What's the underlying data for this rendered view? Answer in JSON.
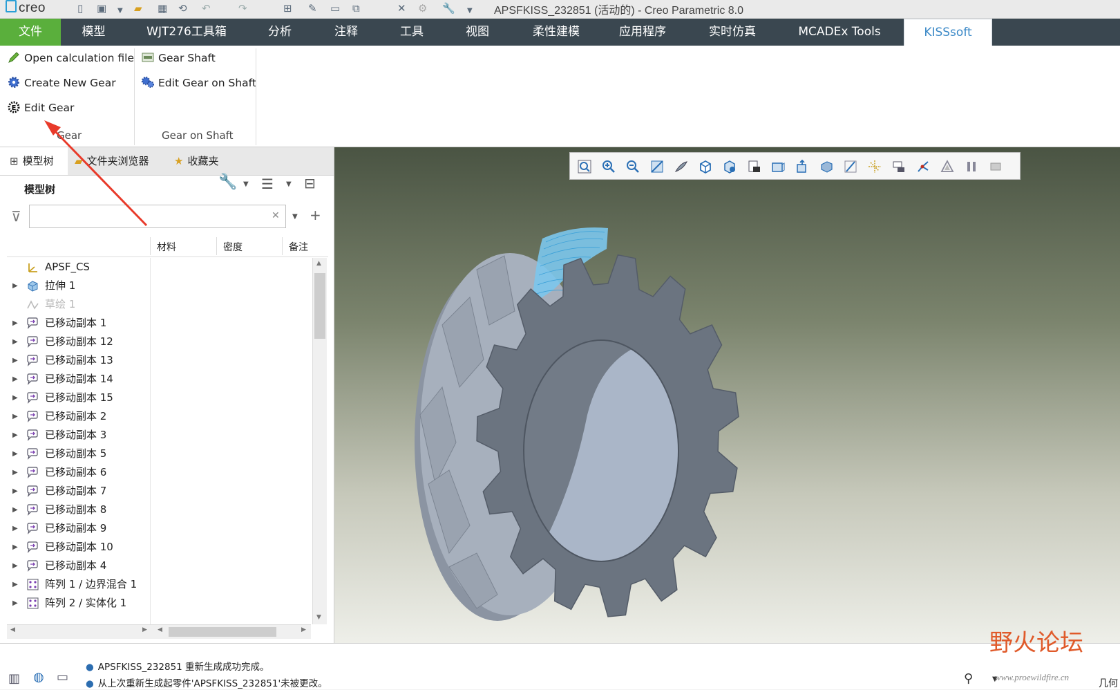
{
  "titlebar": {
    "logo_text": "creo",
    "window_title": "APSFKISS_232851 (活动的) - Creo Parametric 8.0"
  },
  "menu": {
    "tabs": [
      {
        "label": "文件"
      },
      {
        "label": "模型"
      },
      {
        "label": "WJT276工具箱"
      },
      {
        "label": "分析"
      },
      {
        "label": "注释"
      },
      {
        "label": "工具"
      },
      {
        "label": "视图"
      },
      {
        "label": "柔性建模"
      },
      {
        "label": "应用程序"
      },
      {
        "label": "实时仿真"
      },
      {
        "label": "MCADEx Tools"
      },
      {
        "label": "KISSsoft"
      }
    ],
    "active": "KISSsoft"
  },
  "ribbon": {
    "gear_group": {
      "label": "Gear",
      "items": [
        {
          "label": "Open calculation file",
          "icon": "pencil-icon"
        },
        {
          "label": "Create New Gear",
          "icon": "gear-icon"
        },
        {
          "label": "Edit Gear",
          "icon": "edit-gear-icon"
        }
      ]
    },
    "shaft_group": {
      "label": "Gear on Shaft",
      "items": [
        {
          "label": "Gear Shaft",
          "icon": "gear-shaft-icon"
        },
        {
          "label": "Edit Gear on Shaft",
          "icon": "edit-gear-shaft-icon"
        }
      ]
    }
  },
  "left_panel": {
    "tabs": [
      {
        "label": "模型树",
        "icon": "model-tree-icon"
      },
      {
        "label": "文件夹浏览器",
        "icon": "folder-icon"
      },
      {
        "label": "收藏夹",
        "icon": "favorites-icon"
      }
    ],
    "tree_title": "模型树",
    "search": {
      "value": "",
      "placeholder": ""
    },
    "columns": [
      "材料",
      "密度",
      "备注"
    ],
    "rows": [
      {
        "label": "APSF_CS",
        "icon": "coordinate-system-icon",
        "expandable": false,
        "disabled": false
      },
      {
        "label": "拉伸 1",
        "icon": "extrude-icon",
        "expandable": true,
        "disabled": false
      },
      {
        "label": "草绘 1",
        "icon": "sketch-icon",
        "expandable": false,
        "disabled": true
      },
      {
        "label": "已移动副本 1",
        "icon": "moved-copy-icon",
        "expandable": true,
        "disabled": false
      },
      {
        "label": "已移动副本 12",
        "icon": "moved-copy-icon",
        "expandable": true,
        "disabled": false
      },
      {
        "label": "已移动副本 13",
        "icon": "moved-copy-icon",
        "expandable": true,
        "disabled": false
      },
      {
        "label": "已移动副本 14",
        "icon": "moved-copy-icon",
        "expandable": true,
        "disabled": false
      },
      {
        "label": "已移动副本 15",
        "icon": "moved-copy-icon",
        "expandable": true,
        "disabled": false
      },
      {
        "label": "已移动副本 2",
        "icon": "moved-copy-icon",
        "expandable": true,
        "disabled": false
      },
      {
        "label": "已移动副本 3",
        "icon": "moved-copy-icon",
        "expandable": true,
        "disabled": false
      },
      {
        "label": "已移动副本 5",
        "icon": "moved-copy-icon",
        "expandable": true,
        "disabled": false
      },
      {
        "label": "已移动副本 6",
        "icon": "moved-copy-icon",
        "expandable": true,
        "disabled": false
      },
      {
        "label": "已移动副本 7",
        "icon": "moved-copy-icon",
        "expandable": true,
        "disabled": false
      },
      {
        "label": "已移动副本 8",
        "icon": "moved-copy-icon",
        "expandable": true,
        "disabled": false
      },
      {
        "label": "已移动副本 9",
        "icon": "moved-copy-icon",
        "expandable": true,
        "disabled": false
      },
      {
        "label": "已移动副本 10",
        "icon": "moved-copy-icon",
        "expandable": true,
        "disabled": false
      },
      {
        "label": "已移动副本 4",
        "icon": "moved-copy-icon",
        "expandable": true,
        "disabled": false
      },
      {
        "label": "阵列 1 / 边界混合 1",
        "icon": "pattern-icon",
        "expandable": true,
        "disabled": false
      },
      {
        "label": "阵列 2 / 实体化 1",
        "icon": "pattern-icon",
        "expandable": true,
        "disabled": false
      }
    ]
  },
  "status": {
    "messages": [
      "APSFKISS_232851 重新生成成功完成。",
      "从上次重新生成起零件'APSFKISS_232851'未被更改。"
    ],
    "corner_text": "几何"
  },
  "watermark": {
    "text": "野火论坛",
    "url": "www.proewildfire.cn"
  },
  "colors": {
    "menu_bg": "#3a4750",
    "file_tab": "#5aaf3c",
    "active_tab_text": "#3b89c7",
    "gear_body": "#6b7480",
    "annotation_arrow": "#e83a2a"
  }
}
